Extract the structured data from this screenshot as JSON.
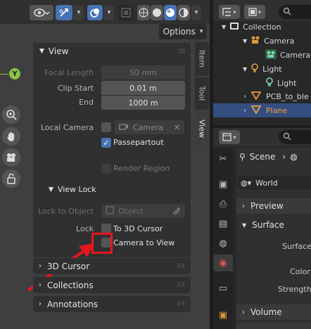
{
  "viewport": {
    "options_label": "Options",
    "gizmo_y_label": "Y"
  },
  "side_tabs": {
    "item": "Item",
    "tool": "Tool",
    "view": "View"
  },
  "view_panel": {
    "title": "View",
    "focal_length_label": "Focal Length",
    "focal_length_value": "50 mm",
    "clip_start_label": "Clip Start",
    "clip_start_value": "0.01 m",
    "clip_end_label": "End",
    "clip_end_value": "1000 m",
    "local_camera_label": "Local Camera",
    "local_camera_value": "Camera",
    "passepartout_label": "Passepartout",
    "passepartout_checked": true,
    "render_region_label": "Render Region",
    "view_lock_title": "View Lock",
    "lock_to_object_label": "Lock to Object",
    "lock_to_object_placeholder": "Object",
    "lock_label": "Lock",
    "to_3d_cursor_label": "To 3D Cursor",
    "camera_to_view_label": "Camera to View"
  },
  "collapsed_panels": [
    "3D Cursor",
    "Collections",
    "Annotations"
  ],
  "outliner": {
    "search_placeholder": "",
    "rows": [
      {
        "label": "Collection",
        "icon": "collection-icon"
      },
      {
        "label": "Camera",
        "icon": "camera-object-icon"
      },
      {
        "label": "Camera",
        "icon": "camera-data-icon"
      },
      {
        "label": "Light",
        "icon": "light-object-icon"
      },
      {
        "label": "Light",
        "icon": "light-data-icon"
      },
      {
        "label": "PCB_to_ble",
        "icon": "mesh-icon"
      },
      {
        "label": "Plane",
        "icon": "mesh-icon"
      }
    ]
  },
  "properties": {
    "scene_label": "Scene",
    "world_value": "World",
    "sections": [
      "Preview",
      "Surface",
      "Volume"
    ],
    "surface_label": "Surface",
    "color_label": "Color",
    "strength_label": "Strength"
  },
  "colors": {
    "accent": "#4772b3",
    "highlight": "#e5161b",
    "selected_row": "#334d80",
    "plane_text": "#f0a040"
  }
}
